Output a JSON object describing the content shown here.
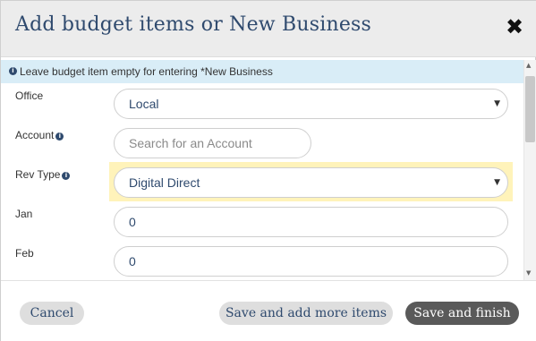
{
  "modal": {
    "title": "Add budget items or New Business",
    "close_glyph": "✖"
  },
  "info_bar": {
    "icon": "info-icon",
    "text": "Leave budget item empty for entering *New Business"
  },
  "form": {
    "office": {
      "label": "Office",
      "value": "Local"
    },
    "account": {
      "label": "Account",
      "placeholder": "Search for an Account",
      "info_icon": "info-icon"
    },
    "rev_type": {
      "label": "Rev Type",
      "value": "Digital Direct",
      "info_icon": "info-icon",
      "highlight_color": "#fff3ba"
    },
    "jan": {
      "label": "Jan",
      "value": "0"
    },
    "feb": {
      "label": "Feb",
      "value": "0"
    }
  },
  "footer": {
    "cancel_label": "Cancel",
    "save_more_label": "Save and add more items",
    "save_finish_label": "Save and finish"
  },
  "colors": {
    "title": "#2f4a6e",
    "info_bar_bg": "#d9edf7",
    "primary_button": "#5a5a5a",
    "secondary_button": "#dedede"
  }
}
